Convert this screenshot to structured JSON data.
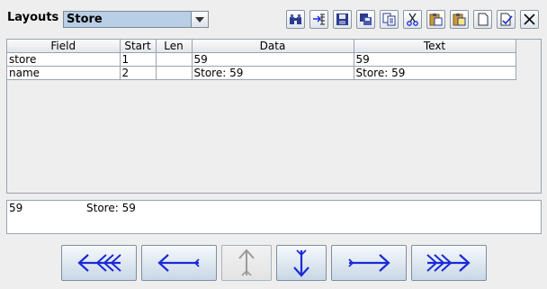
{
  "header": {
    "layouts_label": "Layouts",
    "selected_layout": "Store"
  },
  "toolbar": {
    "icons": [
      "binoculars-icon",
      "insert-icon",
      "save-icon",
      "save-as-icon",
      "copy-icon",
      "cut-icon",
      "paste-icon",
      "paste-special-icon",
      "new-icon",
      "check-icon",
      "close-icon"
    ]
  },
  "table": {
    "columns": [
      "Field",
      "Start",
      "Len",
      "Data",
      "Text"
    ],
    "rows": [
      [
        "store",
        "1",
        "",
        "59",
        "59"
      ],
      [
        "name",
        "2",
        "",
        "Store: 59",
        "Store: 59"
      ]
    ]
  },
  "text_area": {
    "col1": "59",
    "col2": "Store: 59"
  },
  "navigation": {
    "buttons": [
      "first-icon",
      "previous-icon",
      "up-icon",
      "down-icon",
      "next-icon",
      "last-icon"
    ],
    "disabled": [
      "up-icon"
    ]
  },
  "colors": {
    "arrow_blue": "#1a2ad6",
    "arrow_disabled": "#9a9a9a",
    "select_bg": "#b8cfe5"
  }
}
